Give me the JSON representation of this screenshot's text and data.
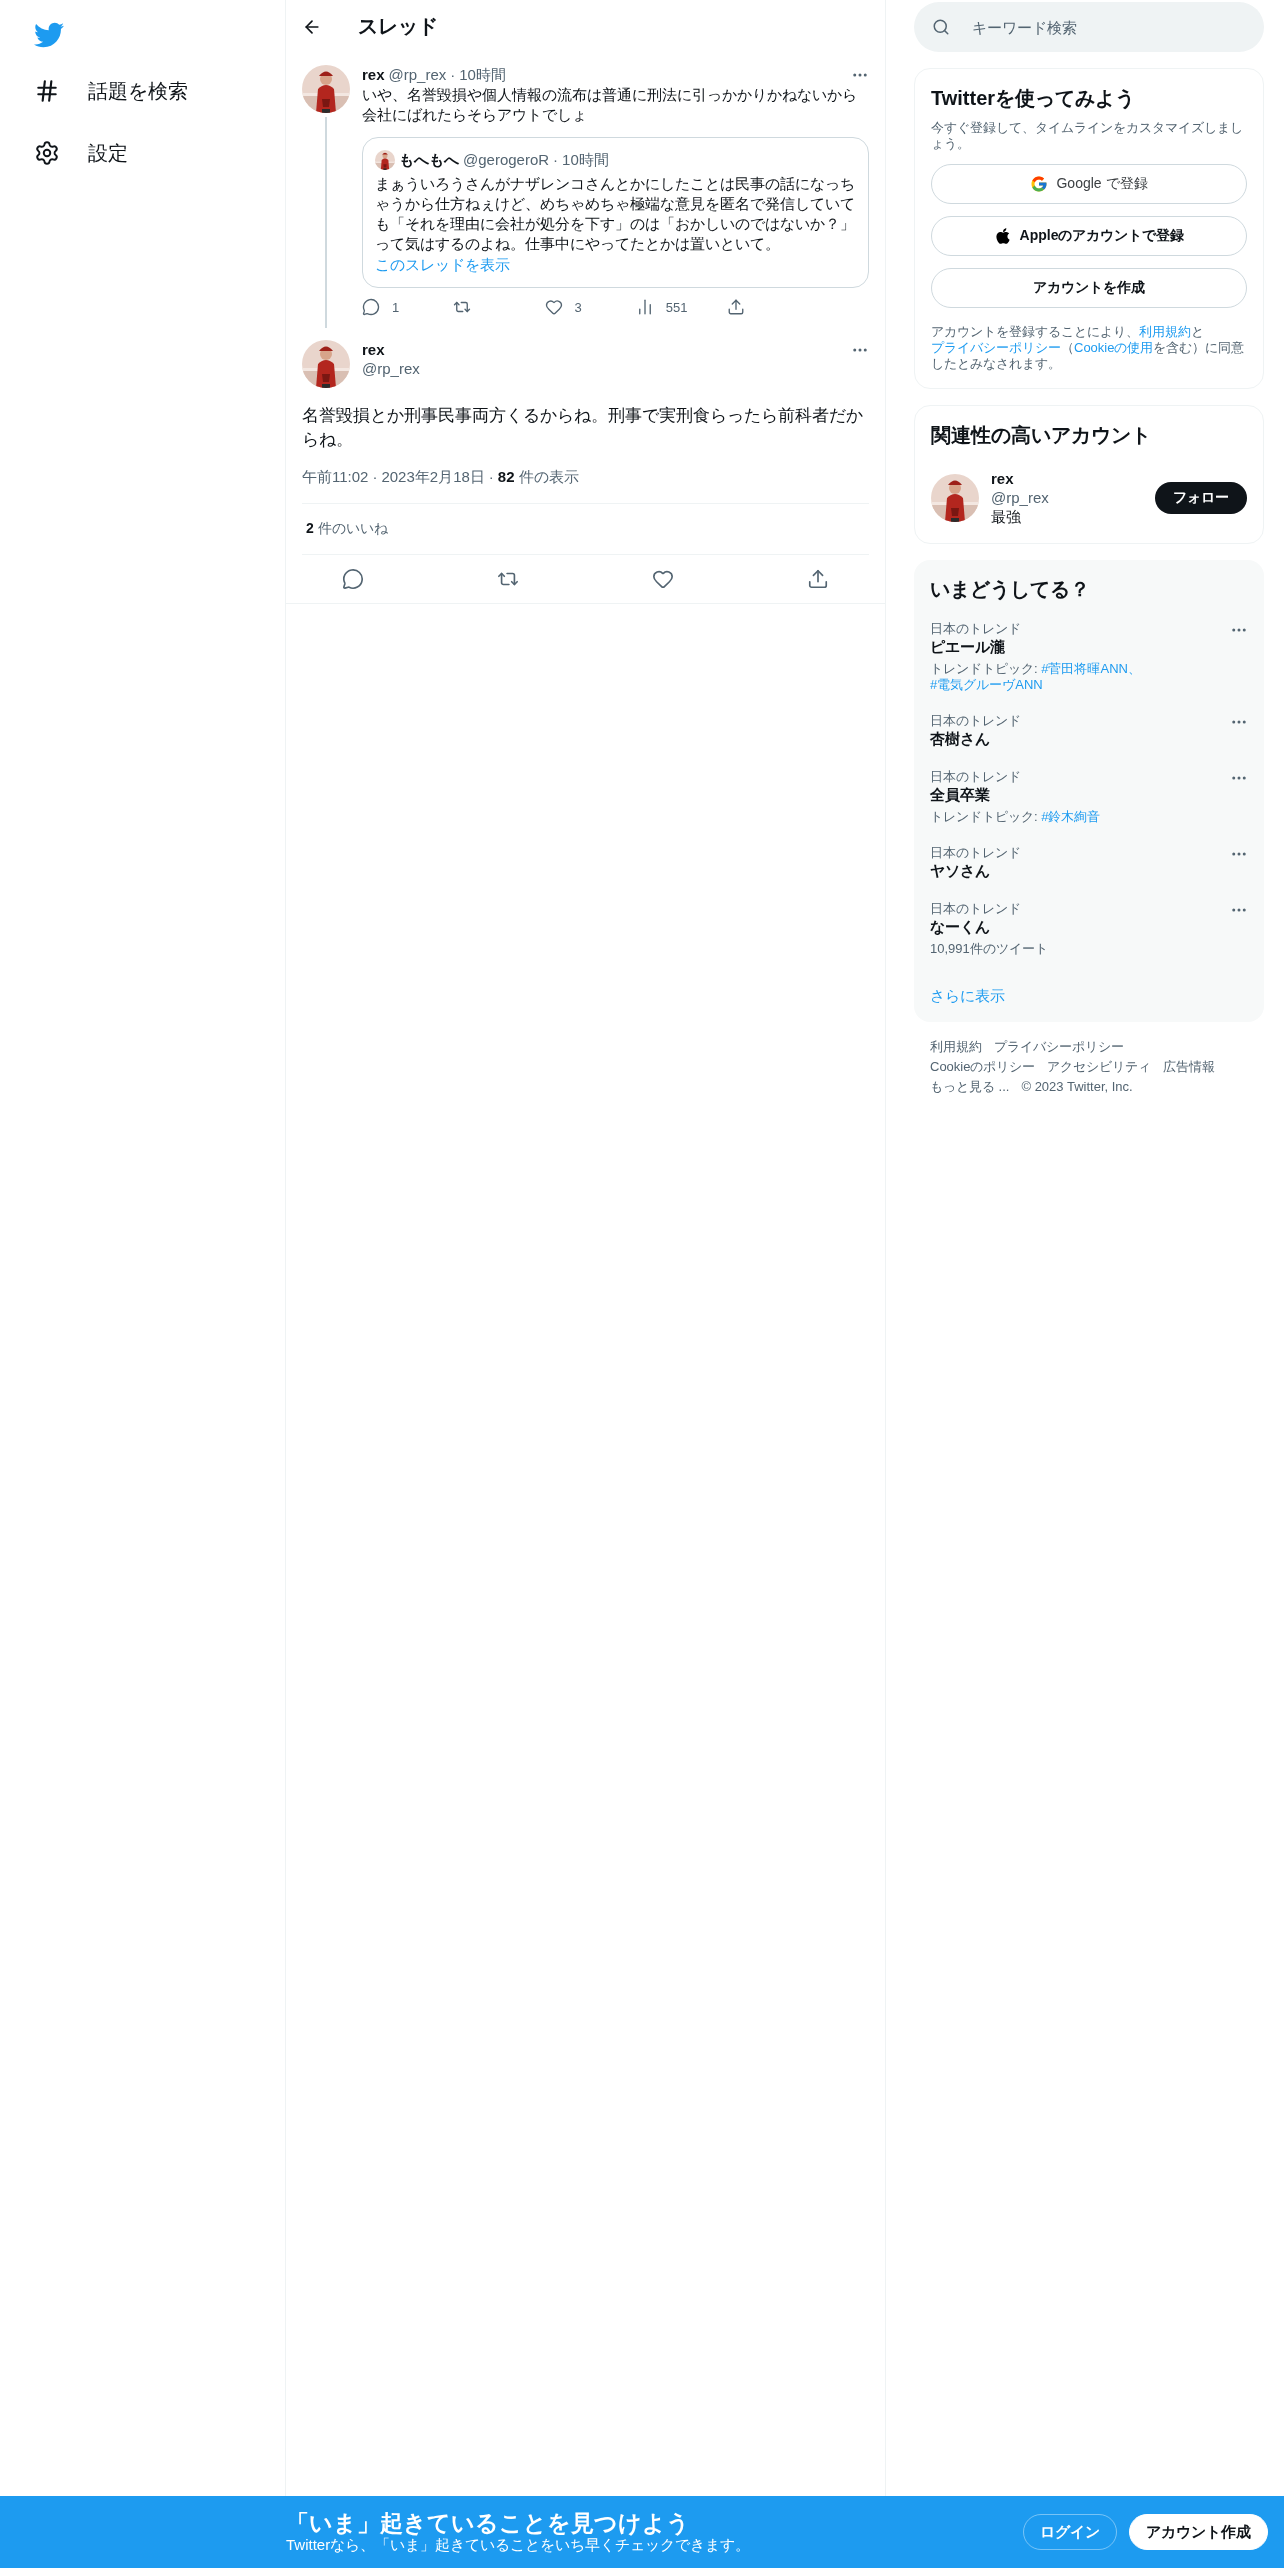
{
  "sidebar": {
    "items": [
      {
        "kind": "explore",
        "label": "話題を検索"
      },
      {
        "kind": "settings",
        "label": "設定"
      }
    ]
  },
  "main": {
    "header": {
      "title": "スレッド"
    },
    "parent_tweet": {
      "name": "rex",
      "handle": "@rp_rex",
      "separator": "·",
      "time": "10時間",
      "text": "いや、名誉毀損や個人情報の流布は普通に刑法に引っかかりかねないから会社にばれたらそらアウトでしょ",
      "quote": {
        "name": "もへもへ",
        "handle": "@gerogeroR",
        "separator": "·",
        "time": "10時間",
        "text": "まぁういろうさんがナザレンコさんとかにしたことは民事の話になっちゃうから仕方ねぇけど、めちゃめちゃ極端な意見を匿名で発信していても「それを理由に会社が処分を下す」のは「おかしいのではないか？」って気はするのよね。仕事中にやってたとかは置いといて。",
        "link": "このスレッドを表示"
      },
      "actions": [
        {
          "kind": "reply",
          "count": "1"
        },
        {
          "kind": "retweet"
        },
        {
          "kind": "like",
          "count": "3"
        },
        {
          "kind": "views",
          "count": "551"
        },
        {
          "kind": "share"
        }
      ]
    },
    "focus_tweet": {
      "name": "rex",
      "handle": "@rp_rex",
      "text": "名誉毀損とか刑事民事両方くるからね。刑事で実刑食らったら前科者だからね。",
      "time": "午前11:02",
      "separator": "·",
      "date": "2023年2月18日",
      "separator_2": "·",
      "views_count": "82",
      "views_label": "件の表示",
      "likes_count": "2",
      "likes_label": "件のいいね",
      "actions": [
        {
          "kind": "reply"
        },
        {
          "kind": "retweet"
        },
        {
          "kind": "like"
        },
        {
          "kind": "share"
        }
      ]
    }
  },
  "right": {
    "search": {
      "placeholder": "キーワード検索"
    },
    "signup": {
      "title": "Twitterを使ってみよう",
      "subtitle": "今すぐ登録して、タイムラインをカスタマイズしましょう。",
      "buttons": [
        {
          "kind": "google",
          "label": "Google で登録"
        },
        {
          "kind": "apple",
          "label": "Appleのアカウントで登録"
        },
        {
          "kind": "plain",
          "label": "アカウントを作成"
        }
      ],
      "legal": [
        {
          "text": "アカウントを登録することにより、",
          "link": false
        },
        {
          "text": "利用規約",
          "link": true
        },
        {
          "text": "と",
          "link": false
        },
        {
          "text": "プライバシーポリシー",
          "link": true
        },
        {
          "text": "（",
          "link": false
        },
        {
          "text": "Cookieの使用",
          "link": true
        },
        {
          "text": "を含む）に同意したとみなされます。",
          "link": false
        }
      ]
    },
    "related": {
      "title": "関連性の高いアカウント",
      "account": {
        "name": "rex",
        "handle": "@rp_rex",
        "bio": "最強",
        "button": "フォロー"
      }
    },
    "trends": {
      "title": "いまどうしてる？",
      "items": [
        {
          "context": "日本のトレンド",
          "name": "ピエール瀧",
          "topic_label": "トレンドトピック: ",
          "topics": [
            "#菅田将暉ANN、",
            "#電気グルーヴANN"
          ]
        },
        {
          "context": "日本のトレンド",
          "name": "杏樹さん"
        },
        {
          "context": "日本のトレンド",
          "name": "全員卒業",
          "topic_label": "トレンドトピック: ",
          "topics": [
            "#鈴木絢音"
          ]
        },
        {
          "context": "日本のトレンド",
          "name": "ヤソさん"
        },
        {
          "context": "日本のトレンド",
          "name": "なーくん",
          "count": "10,991件のツイート"
        }
      ],
      "more": "さらに表示"
    },
    "footer": [
      [
        "利用規約",
        "プライバシーポリシー"
      ],
      [
        "Cookieのポリシー",
        "アクセシビリティ",
        "広告情報"
      ],
      [
        "もっと見る ...",
        "© 2023 Twitter, Inc."
      ]
    ]
  },
  "bottom_bar": {
    "title": "「いま」起きていることを見つけよう",
    "subtitle": "Twitterなら、「いま」起きていることをいち早くチェックできます。",
    "buttons": [
      {
        "kind": "outline",
        "label": "ログイン"
      },
      {
        "kind": "filled",
        "label": "アカウント作成"
      }
    ]
  }
}
